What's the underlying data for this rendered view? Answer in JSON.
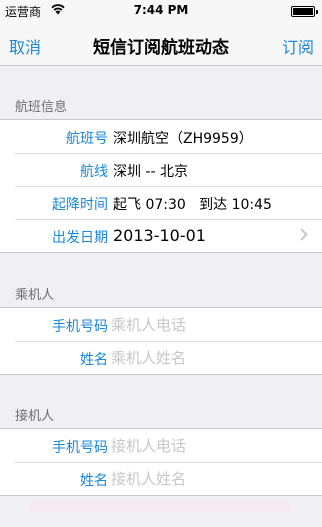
{
  "status_bar": {
    "carrier": "运营商",
    "time": "7:44 PM"
  },
  "nav": {
    "left_button": "取消",
    "title": "短信订阅航班动态",
    "right_button": "订阅"
  },
  "flight_info": {
    "header": "航班信息",
    "rows": [
      {
        "label": "航班号",
        "value": "深圳航空（ZH9959）"
      },
      {
        "label": "航线",
        "value": "深圳 -- 北京"
      },
      {
        "label": "起降时间",
        "value": "起飞 07:30   到达 10:45"
      },
      {
        "label": "出发日期",
        "value": "2013-10-01"
      }
    ]
  },
  "passenger": {
    "header": "乘机人",
    "phone_label": "手机号码",
    "phone_placeholder": "乘机人电话",
    "name_label": "姓名",
    "name_placeholder": "乘机人姓名"
  },
  "pickup": {
    "header": "接机人",
    "phone_label": "手机号码",
    "phone_placeholder": "接机人电话",
    "name_label": "姓名",
    "name_placeholder": "接机人姓名"
  },
  "colors": {
    "accent": "#1a87d8",
    "background": "#efeff4",
    "placeholder": "#c7c7cd"
  },
  "icons": {
    "wifi": "wifi-icon",
    "battery": "battery-icon",
    "chevron": "chevron-right-icon"
  }
}
